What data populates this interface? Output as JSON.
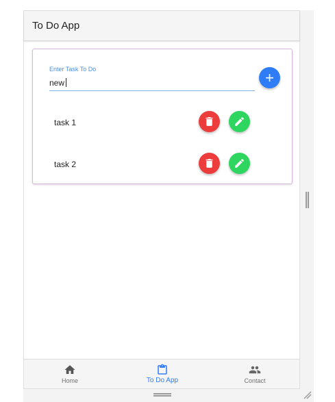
{
  "app": {
    "title": "To Do App"
  },
  "form": {
    "label": "Enter Task To Do",
    "value": "new",
    "add_icon": "plus-icon"
  },
  "tasks": [
    {
      "label": "task 1",
      "delete_icon": "trash-icon",
      "edit_icon": "pencil-icon"
    },
    {
      "label": "task 2",
      "delete_icon": "trash-icon",
      "edit_icon": "pencil-icon"
    }
  ],
  "bottom_nav": {
    "items": [
      {
        "label": "Home",
        "icon": "home-icon",
        "active": false
      },
      {
        "label": "To Do App",
        "icon": "clipboard-icon",
        "active": true
      },
      {
        "label": "Contact",
        "icon": "contacts-icon",
        "active": false
      }
    ]
  },
  "colors": {
    "accent": "#2f7df6",
    "delete": "#ec3c3c",
    "edit": "#2ed660",
    "card_border": "#d7b8dc"
  }
}
